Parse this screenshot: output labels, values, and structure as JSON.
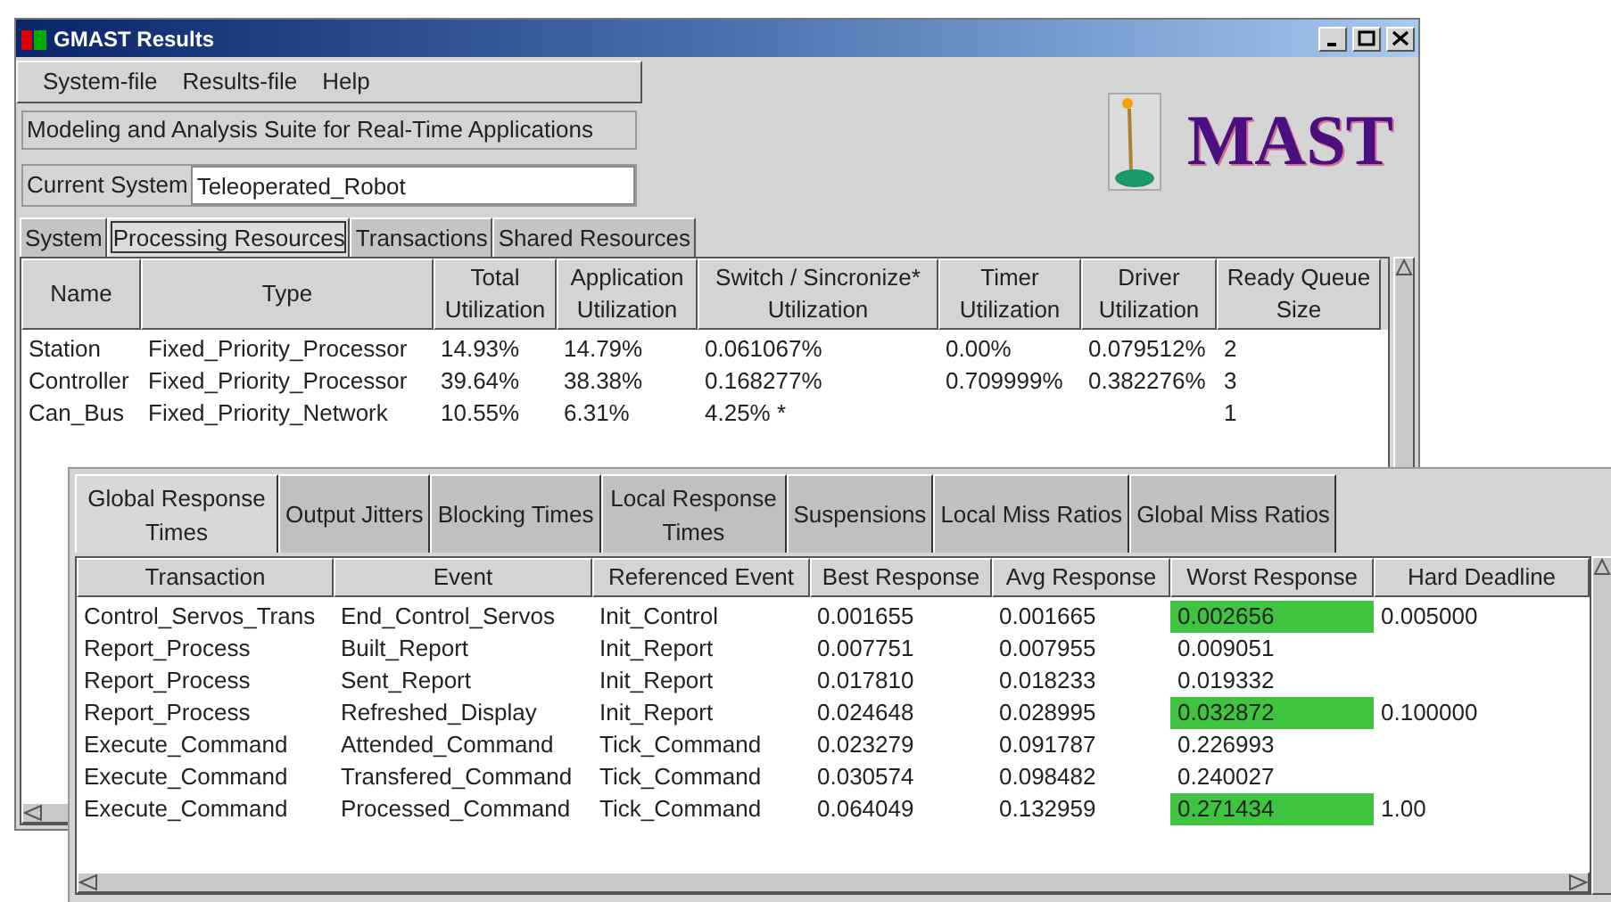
{
  "window": {
    "title": "GMAST Results"
  },
  "menu": [
    "System-file",
    "Results-file",
    "Help"
  ],
  "suite_label": "Modeling and Analysis Suite for Real-Time Applications",
  "current_system": {
    "label": "Current System",
    "value": "Teleoperated_Robot"
  },
  "logo": {
    "text": "MAST"
  },
  "tabs": [
    {
      "label": "System",
      "selected": false
    },
    {
      "label": "Processing Resources",
      "selected": true
    },
    {
      "label": "Transactions",
      "selected": false
    },
    {
      "label": "Shared Resources",
      "selected": false
    }
  ],
  "resources_table": {
    "columns": [
      "Name",
      "Type",
      "Total Utilization",
      "Application Utilization",
      "Switch / Sincronize* Utilization",
      "Timer Utilization",
      "Driver Utilization",
      "Ready Queue Size"
    ],
    "rows": [
      [
        "Station",
        "Fixed_Priority_Processor",
        "14.93%",
        "14.79%",
        "0.061067%",
        "0.00%",
        "0.079512%",
        "2"
      ],
      [
        "Controller",
        "Fixed_Priority_Processor",
        "39.64%",
        "38.38%",
        "0.168277%",
        "0.709999%",
        "0.382276%",
        "3"
      ],
      [
        "Can_Bus",
        "Fixed_Priority_Network",
        "10.55%",
        "6.31%",
        "4.25% *",
        "",
        "",
        "1"
      ]
    ]
  },
  "results_tabs": [
    {
      "label": "Global Response Times",
      "selected": true
    },
    {
      "label": "Output Jitters",
      "selected": false
    },
    {
      "label": "Blocking Times",
      "selected": false
    },
    {
      "label": "Local Response Times",
      "selected": false
    },
    {
      "label": "Suspensions",
      "selected": false
    },
    {
      "label": "Local Miss Ratios",
      "selected": false
    },
    {
      "label": "Global Miss Ratios",
      "selected": false
    }
  ],
  "response_table": {
    "columns": [
      "Transaction",
      "Event",
      "Referenced Event",
      "Best Response",
      "Avg Response",
      "Worst Response",
      "Hard Deadline"
    ],
    "rows": [
      {
        "cells": [
          "Control_Servos_Trans",
          "End_Control_Servos",
          "Init_Control",
          "0.001655",
          "0.001665",
          "0.002656",
          "0.005000"
        ],
        "highlighted": true
      },
      {
        "cells": [
          "Report_Process",
          "Built_Report",
          "Init_Report",
          "0.007751",
          "0.007955",
          "0.009051",
          ""
        ],
        "highlighted": false
      },
      {
        "cells": [
          "Report_Process",
          "Sent_Report",
          "Init_Report",
          "0.017810",
          "0.018233",
          "0.019332",
          ""
        ],
        "highlighted": false
      },
      {
        "cells": [
          "Report_Process",
          "Refreshed_Display",
          "Init_Report",
          "0.024648",
          "0.028995",
          "0.032872",
          "0.100000"
        ],
        "highlighted": true
      },
      {
        "cells": [
          "Execute_Command",
          "Attended_Command",
          "Tick_Command",
          "0.023279",
          "0.091787",
          "0.226993",
          ""
        ],
        "highlighted": false
      },
      {
        "cells": [
          "Execute_Command",
          "Transfered_Command",
          "Tick_Command",
          "0.030574",
          "0.098482",
          "0.240027",
          ""
        ],
        "highlighted": false
      },
      {
        "cells": [
          "Execute_Command",
          "Processed_Command",
          "Tick_Command",
          "0.064049",
          "0.132959",
          "0.271434",
          "1.00"
        ],
        "highlighted": true
      }
    ]
  }
}
